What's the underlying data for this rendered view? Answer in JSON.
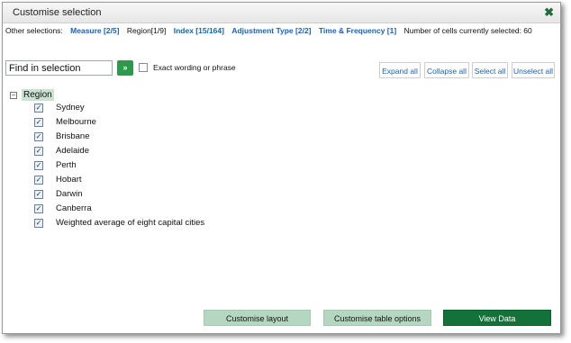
{
  "dialog": {
    "title": "Customise selection",
    "close_glyph": "✖"
  },
  "selections": {
    "label": "Other selections:",
    "measure": "Measure [2/5]",
    "region": "Region[1/9]",
    "index": "Index [15/164]",
    "adjustment": "Adjustment Type [2/2]",
    "time_frequency": "Time & Frequency [1]",
    "cells_text": "Number of cells currently selected: 60"
  },
  "search": {
    "value": "Find in selection",
    "go_glyph": "»",
    "exact_label": "Exact wording or phrase"
  },
  "tools": {
    "expand_all": "Expand all",
    "collapse_all": "Collapse all",
    "select_all": "Select all",
    "unselect_all": "Unselect all"
  },
  "tree": {
    "toggle_glyph": "−",
    "root_label": "Region",
    "check_glyph": "✓",
    "items": [
      "Sydney",
      "Melbourne",
      "Brisbane",
      "Adelaide",
      "Perth",
      "Hobart",
      "Darwin",
      "Canberra",
      "Weighted average of eight capital cities"
    ]
  },
  "footer": {
    "customise_layout": "Customise layout",
    "customise_table_options": "Customise table options",
    "view_data": "View Data"
  },
  "colors": {
    "accent_green": "#13713a",
    "light_green": "#b5d7c1",
    "link_blue": "#1763b8"
  }
}
